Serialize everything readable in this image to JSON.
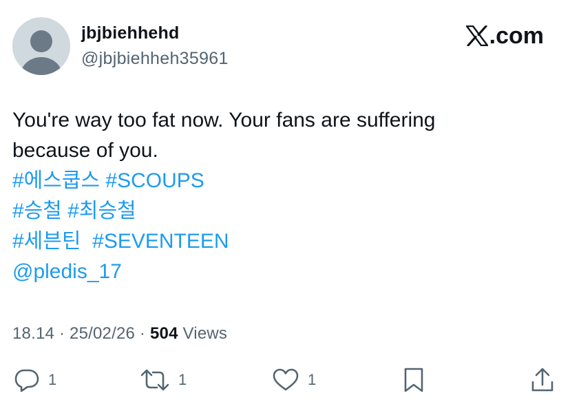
{
  "tweet": {
    "display_name": "jbjbiehhehd",
    "handle": "@jbjbiehheh35961",
    "brand": ".com",
    "text_line1": "You're way too fat now. Your fans are suffering",
    "text_line2": "because of you.",
    "hashtags_line1": "#에스쿱스 #SCOUPS",
    "hashtags_line2": "#승철 #최승철",
    "hashtags_line3": "#세븐틴  #SEVENTEEN",
    "mention": "@pledis_17",
    "time": "18.14",
    "separator": "·",
    "date": "25/02/26",
    "views_count": "504",
    "views_label": "Views"
  },
  "actions": {
    "reply_count": "1",
    "retweet_count": "1",
    "like_count": "1"
  },
  "icons": {
    "brand": "x-logo-icon",
    "reply": "reply-icon",
    "retweet": "retweet-icon",
    "like": "heart-icon",
    "bookmark": "bookmark-icon",
    "share": "share-icon"
  },
  "colors": {
    "link": "#1d9bf0",
    "secondary_text": "#536471",
    "primary_text": "#0f1419",
    "avatar_bg": "#cfd9de"
  }
}
